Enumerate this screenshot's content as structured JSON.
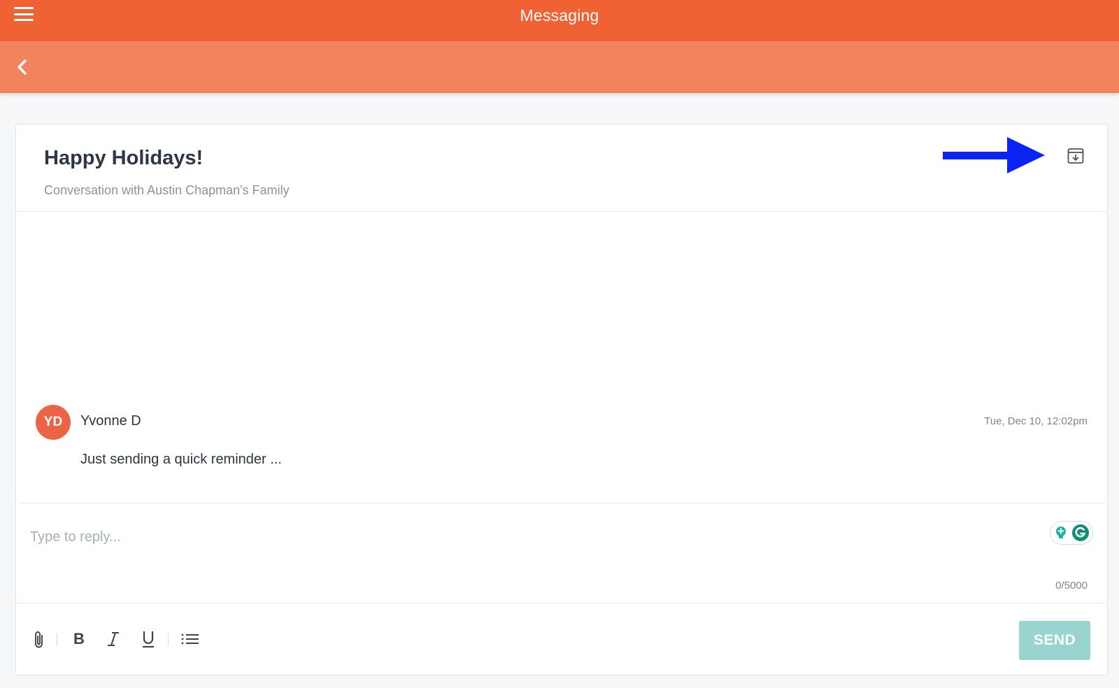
{
  "app": {
    "title": "Messaging"
  },
  "conversation": {
    "title": "Happy Holidays!",
    "subtitle": "Conversation with Austin Chapman's Family"
  },
  "message": {
    "avatar_initials": "YD",
    "sender": "Yvonne D",
    "timestamp": "Tue, Dec 10, 12:02pm",
    "body": "Just sending a quick reminder ..."
  },
  "reply": {
    "placeholder": "Type to reply...",
    "char_count": "0/5000"
  },
  "toolbar": {
    "send_label": "SEND",
    "bold_glyph": "B"
  },
  "colors": {
    "topbar": "#f06133",
    "subbar": "#f2845d",
    "avatar": "#ea6445",
    "send_button": "#99d4cf",
    "annotation_arrow": "#0a24f5"
  },
  "icons": [
    "menu-icon",
    "back-chevron-icon",
    "archive-icon",
    "annotation-arrow",
    "grammarly-icon",
    "attachment-icon",
    "bold-icon",
    "italic-icon",
    "underline-icon",
    "list-icon"
  ]
}
